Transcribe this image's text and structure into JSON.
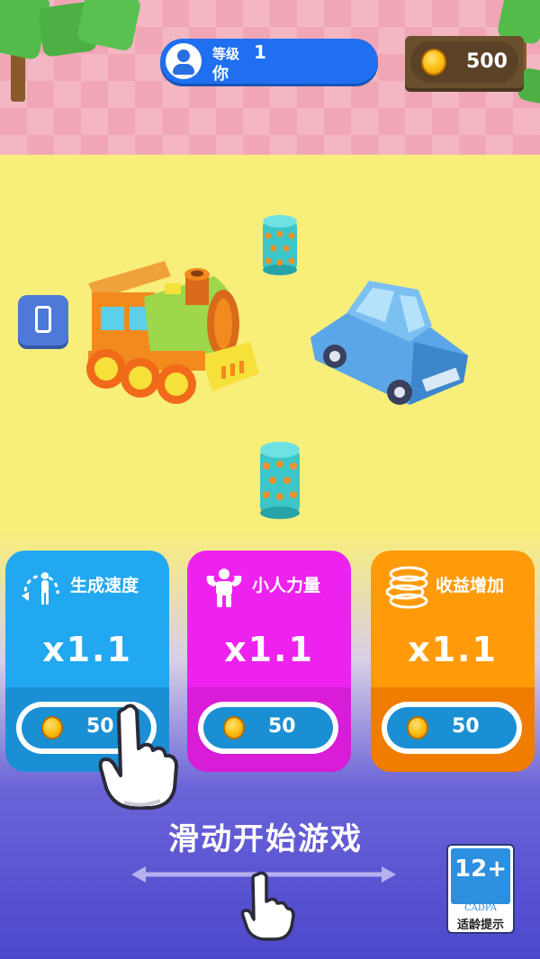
{
  "header": {
    "level_label": "等级",
    "level_value": "1",
    "player_name": "你",
    "coins": "500"
  },
  "upgrades": [
    {
      "title": "生成速度",
      "multiplier": "x1.1",
      "price": "50",
      "icon": "speed-person-icon",
      "color": "#22a8f0"
    },
    {
      "title": "小人力量",
      "multiplier": "x1.1",
      "price": "50",
      "icon": "muscle-person-icon",
      "color": "#ee22ee"
    },
    {
      "title": "收益增加",
      "multiplier": "x1.1",
      "price": "50",
      "icon": "coin-stack-icon",
      "color": "#ff9b0a"
    }
  ],
  "start_hint": "滑动开始游戏",
  "age_rating": {
    "rating": "12+",
    "org": "CADPA",
    "label": "适龄提示"
  }
}
